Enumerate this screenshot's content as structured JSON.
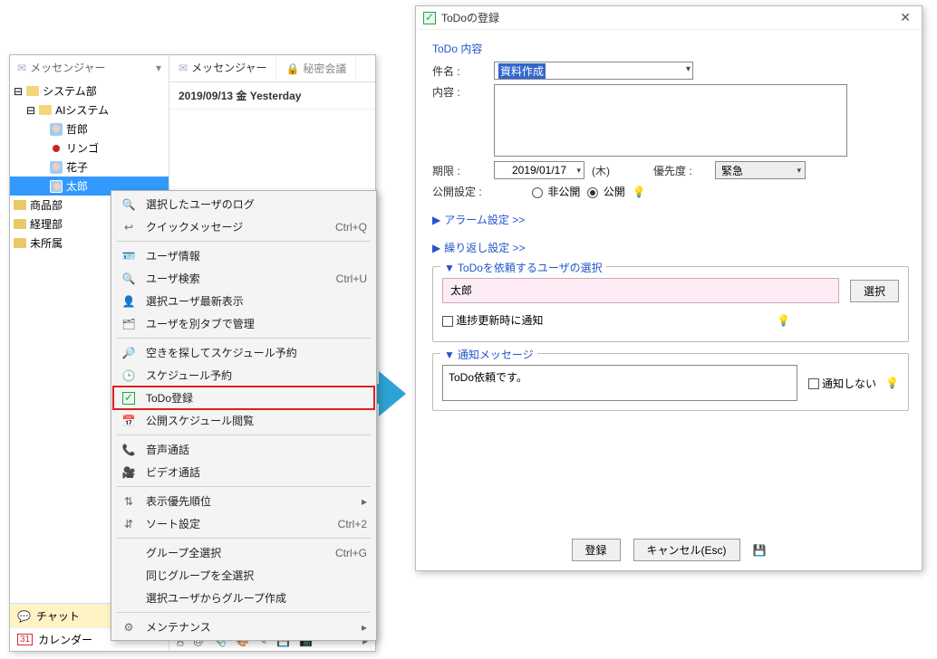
{
  "left": {
    "messenger_tab": "メッセンジャー",
    "secret_tab": "秘密会議",
    "date_header": "2019/09/13 金 Yesterday",
    "sidebar_title": "メッセンジャー",
    "tree": {
      "root": "システム部",
      "ai": "AIシステム",
      "u1": "哲郎",
      "u2": "リンゴ",
      "u3": "花子",
      "u4": "太郎",
      "dept2": "商品部",
      "dept3": "経理部",
      "dept4": "未所属"
    },
    "bottom": {
      "chat": "チャット",
      "calendar": "カレンダー"
    }
  },
  "ctx": {
    "log": "選択したユーザのログ",
    "quick": "クイックメッセージ",
    "quick_sc": "Ctrl+Q",
    "uinfo": "ユーザ情報",
    "usearch": "ユーザ検索",
    "usearch_sc": "Ctrl+U",
    "ulatest": "選択ユーザ最新表示",
    "utabs": "ユーザを別タブで管理",
    "findslot": "空きを探してスケジュール予約",
    "sched": "スケジュール予約",
    "todo": "ToDo登録",
    "publicsched": "公開スケジュール閲覧",
    "voice": "音声通話",
    "video": "ビデオ通話",
    "dispprio": "表示優先順位",
    "sort": "ソート設定",
    "sort_sc": "Ctrl+2",
    "selgroup": "グループ全選択",
    "selgroup_sc": "Ctrl+G",
    "samegroup": "同じグループを全選択",
    "makegroup": "選択ユーザからグループ作成",
    "maint": "メンテナンス"
  },
  "dlg": {
    "title": "ToDoの登録",
    "section": "ToDo 内容",
    "subject_lbl": "件名 :",
    "subject_val": "資料作成",
    "content_lbl": "内容 :",
    "deadline_lbl": "期限 :",
    "deadline_val": "2019/01/17",
    "dow": "(木)",
    "priority_lbl": "優先度 :",
    "priority_val": "緊急",
    "visibility_lbl": "公開設定 :",
    "vis_private": "非公開",
    "vis_public": "公開",
    "alarm": "アラーム設定 >>",
    "repeat": "繰り返し設定 >>",
    "assign_legend": "ToDoを依頼するユーザの選択",
    "assign_user": "太郎",
    "select_btn": "選択",
    "progress_notify": "進捗更新時に通知",
    "notify_legend": "通知メッセージ",
    "notify_text": "ToDo依頼です。",
    "no_notify": "通知しない",
    "register": "登録",
    "cancel": "キャンセル(Esc)"
  }
}
